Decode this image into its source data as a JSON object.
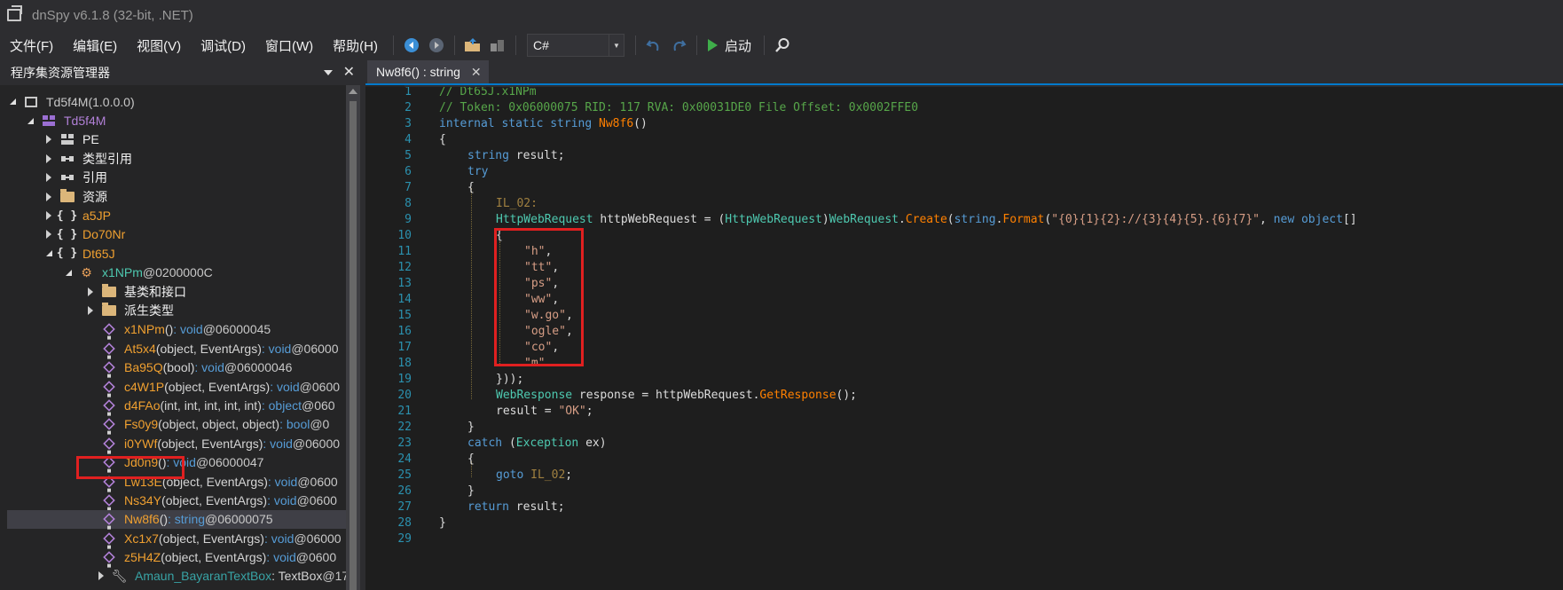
{
  "window": {
    "title": "dnSpy v6.1.8 (32-bit, .NET)"
  },
  "menu": [
    "文件(F)",
    "编辑(E)",
    "视图(V)",
    "调试(D)",
    "窗口(W)",
    "帮助(H)"
  ],
  "toolbar": {
    "language": "C#",
    "start_label": "启动"
  },
  "explorer": {
    "title": "程序集资源管理器",
    "tree": [
      {
        "name": "Td5f4M",
        "suffix": " (1.0.0.0)"
      },
      {
        "name": "Td5f4M"
      },
      {
        "name": "PE"
      },
      {
        "name": "类型引用"
      },
      {
        "name": "引用"
      },
      {
        "name": "资源"
      },
      {
        "name": "a5JP"
      },
      {
        "name": "Do70Nr"
      },
      {
        "name": "Dt65J"
      },
      {
        "name": "x1NPm",
        "addr": " @0200000C"
      },
      {
        "name": "基类和接口"
      },
      {
        "name": "派生类型"
      },
      {
        "name": "x1NPm",
        "sig": "()",
        "ret": " : void",
        "addr": " @06000045"
      },
      {
        "name": "At5x4",
        "sig": "(object, EventArgs)",
        "ret": " : void",
        "addr": " @06000"
      },
      {
        "name": "Ba95Q",
        "sig": "(bool)",
        "ret": " : void",
        "addr": " @06000046"
      },
      {
        "name": "c4W1P",
        "sig": "(object, EventArgs)",
        "ret": " : void",
        "addr": " @0600"
      },
      {
        "name": "d4FAo",
        "sig": "(int, int, int, int, int)",
        "ret": " : object",
        "addr": " @060"
      },
      {
        "name": "Fs0y9",
        "sig": "(object, object, object)",
        "ret": " : bool",
        "addr": " @0"
      },
      {
        "name": "i0YWf",
        "sig": "(object, EventArgs)",
        "ret": " : void",
        "addr": " @06000"
      },
      {
        "name": "Jd0n9",
        "sig": "()",
        "ret": " : void",
        "addr": " @06000047"
      },
      {
        "name": "Lw13E",
        "sig": "(object, EventArgs)",
        "ret": " : void",
        "addr": " @0600"
      },
      {
        "name": "Ns34Y",
        "sig": "(object, EventArgs)",
        "ret": " : void",
        "addr": " @0600"
      },
      {
        "name": "Nw8f6",
        "sig": "()",
        "ret": " : string",
        "addr": " @06000075"
      },
      {
        "name": "Xc1x7",
        "sig": "(object, EventArgs)",
        "ret": " : void",
        "addr": " @06000"
      },
      {
        "name": "z5H4Z",
        "sig": "(object, EventArgs)",
        "ret": " : void",
        "addr": " @0600"
      },
      {
        "name": "Amaun_BayaranTextBox",
        "ret": " : TextBox",
        "addr": " @17("
      }
    ]
  },
  "editor": {
    "tab_label": "Nw8f6() : string",
    "line_numbers": [
      "1",
      "2",
      "3",
      "4",
      "5",
      "6",
      "7",
      "8",
      "9",
      "10",
      "11",
      "12",
      "13",
      "14",
      "15",
      "16",
      "17",
      "18",
      "19",
      "20",
      "21",
      "22",
      "23",
      "24",
      "25",
      "26",
      "27",
      "28",
      "29"
    ],
    "code": {
      "l1": "// Dt65J.x1NPm",
      "l2": "// Token: 0x06000075 RID: 117 RVA: 0x00031DE0 File Offset: 0x0002FFE0",
      "l3_kw": "internal static string ",
      "l3_name": "Nw8f6",
      "l3_end": "()",
      "l4": "{",
      "l5_kw": "string",
      "l5_rest": " result;",
      "l6": "try",
      "l7": "{",
      "l8": "IL_02:",
      "l9_t1": "HttpWebRequest",
      "l9_p1": " httpWebRequest = (",
      "l9_t2": "HttpWebRequest",
      "l9_p2": ")",
      "l9_t3": "WebRequest",
      "l9_p3": ".",
      "l9_f1": "Create",
      "l9_p4": "(",
      "l9_k1": "string",
      "l9_p5": ".",
      "l9_f2": "Format",
      "l9_p6": "(",
      "l9_s1": "\"{0}{1}{2}://{3}{4}{5}.{6}{7}\"",
      "l9_p7": ", ",
      "l9_k2": "new object",
      "l9_p8": "[]",
      "l10": "{",
      "l11": "\"h\"",
      "l12": "\"tt\"",
      "l13": "\"ps\"",
      "l14": "\"ww\"",
      "l15": "\"w.go\"",
      "l16": "\"ogle\"",
      "l17": "\"co\"",
      "l18": "\"m\"",
      "comma": ",",
      "l19": "}));",
      "l20_t": "WebResponse",
      "l20_p1": " response = httpWebRequest.",
      "l20_f": "GetResponse",
      "l20_p2": "();",
      "l21_p": "result = ",
      "l21_s": "\"OK\"",
      "l21_e": ";",
      "l22": "}",
      "l23_k": "catch",
      "l23_p1": " (",
      "l23_t": "Exception",
      "l23_p2": " ex)",
      "l24": "{",
      "l25_k": "goto",
      "l25_l": " IL_02",
      "l25_e": ";",
      "l26": "}",
      "l27_k": "return",
      "l27_p": " result;",
      "l28": "}"
    }
  },
  "colors": {
    "accent": "#007acc",
    "highlight": "#e02020",
    "keyword": "#569cd6",
    "type": "#4ec9b0",
    "string": "#d69d85",
    "comment": "#57a64a",
    "method": "#ff8000"
  }
}
